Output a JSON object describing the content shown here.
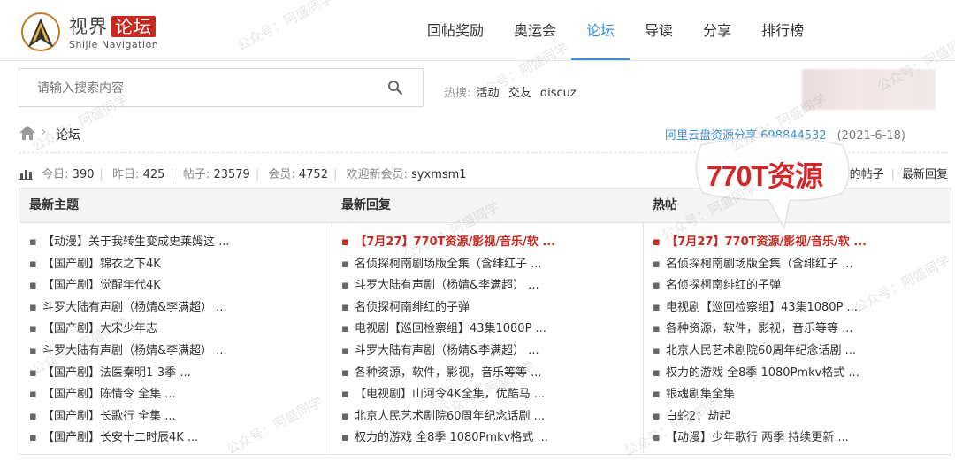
{
  "brand": {
    "title": "视界",
    "tag": "论坛",
    "subtitle": "Shijie Navigation"
  },
  "nav": [
    {
      "label": "回帖奖励"
    },
    {
      "label": "奥运会"
    },
    {
      "label": "论坛",
      "active": true
    },
    {
      "label": "导读"
    },
    {
      "label": "分享"
    },
    {
      "label": "排行榜"
    }
  ],
  "search": {
    "placeholder": "请输入搜索内容"
  },
  "hot_searches": {
    "label": "热搜:",
    "items": [
      "活动",
      "交友",
      "discuz"
    ]
  },
  "breadcrumb": {
    "current": "论坛"
  },
  "notice": {
    "text": "阿里云盘资源分享 698844532",
    "date": "(2021-6-18)"
  },
  "stats": {
    "today_label": "今日:",
    "today": "390",
    "yesterday_label": "昨日:",
    "yesterday": "425",
    "posts_label": "帖子:",
    "posts": "23579",
    "members_label": "会员:",
    "members": "4752",
    "welcome_label": "欢迎新会员:",
    "new_member": "syxmsm1"
  },
  "quick_links": [
    "我的帖子",
    "最新回复"
  ],
  "callout": {
    "text": "770T资源"
  },
  "columns": [
    {
      "title": "最新主题",
      "items": [
        "【动漫】关于我转生变成史莱姆这 ...",
        "【国产剧】锦衣之下4K",
        "【国产剧】觉醒年代4K",
        "斗罗大陆有声剧（杨婧&李满超） ...",
        "【国产剧】大宋少年志",
        "斗罗大陆有声剧（杨婧&李满超） ...",
        "【国产剧】法医秦明1-3季 ...",
        "【国产剧】陈情令 全集 ...",
        "【国产剧】长歌行 全集 ...",
        "【国产剧】长安十二时辰4K ..."
      ]
    },
    {
      "title": "最新回复",
      "items": [
        "【7月27】770T资源/影视/音乐/软 ...",
        "名侦探柯南剧场版全集（含绯红子 ...",
        "斗罗大陆有声剧（杨婧&李满超） ...",
        "名侦探柯南绯红的子弹",
        "电视剧【巡回检察组】43集1080P ...",
        "斗罗大陆有声剧（杨婧&李满超） ...",
        "各种资源，软件，影视，音乐等等 ...",
        "【电视剧】山河令4K全集，优酷马 ...",
        "北京人民艺术剧院60周年纪念话剧 ...",
        "权力的游戏 全8季 1080Pmkv格式 ..."
      ]
    },
    {
      "title": "热帖",
      "items": [
        "【7月27】770T资源/影视/音乐/软 ...",
        "名侦探柯南剧场版全集（含绯红子 ...",
        "名侦探柯南绯红的子弹",
        "电视剧【巡回检察组】43集1080P ...",
        "各种资源，软件，影视，音乐等等 ...",
        "北京人民艺术剧院60周年纪念话剧 ...",
        "权力的游戏 全8季 1080Pmkv格式 ...",
        "银魂剧集全集",
        "白蛇2：劫起",
        "【动漫】少年歌行 两季 持续更新 ..."
      ]
    }
  ],
  "watermark": "公众号：阿盛同学",
  "colors": {
    "accent": "#3a8fd6",
    "highlight": "#c9281f",
    "brand": "#c07a28"
  }
}
